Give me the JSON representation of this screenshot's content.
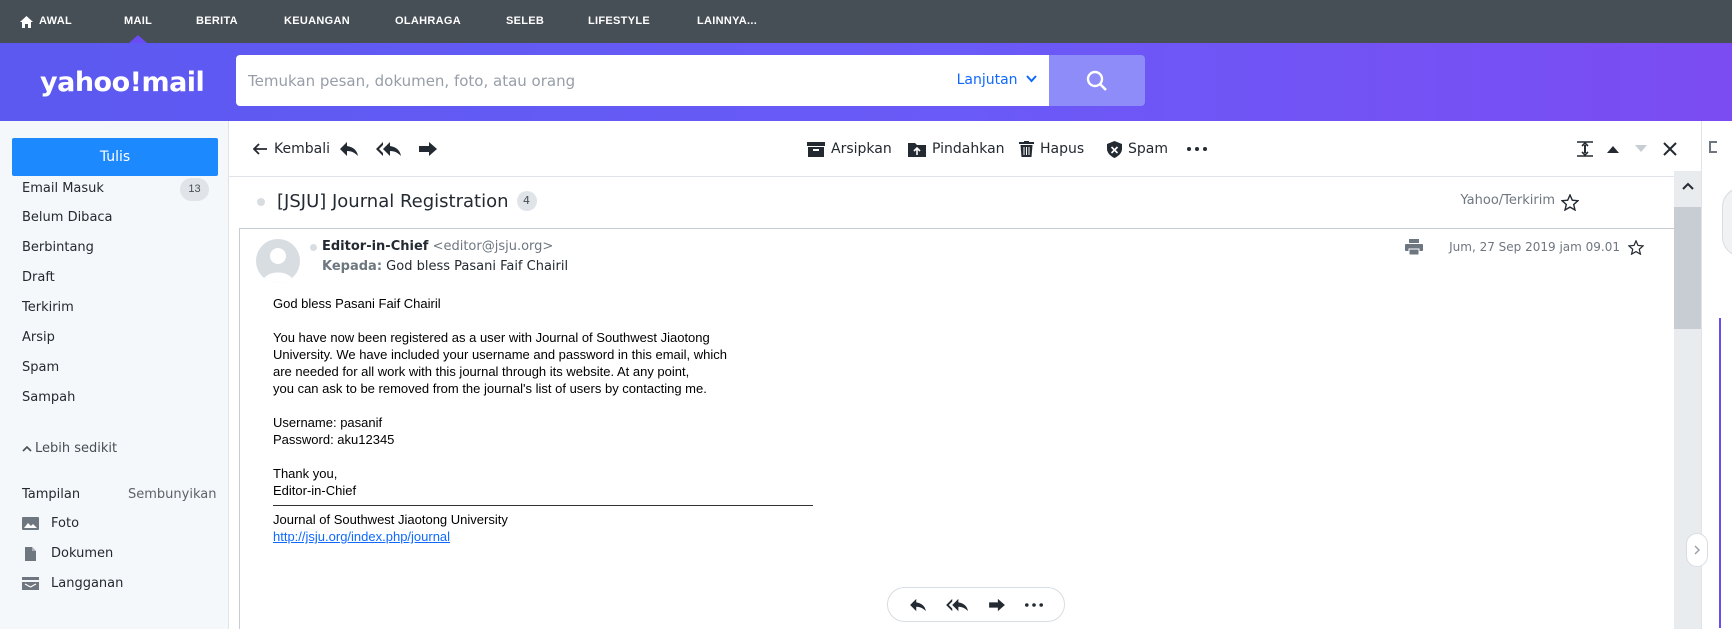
{
  "nav": {
    "items": [
      "AWAL",
      "MAIL",
      "BERITA",
      "KEUANGAN",
      "OLAHRAGA",
      "SELEB",
      "LIFESTYLE",
      "LAINNYA..."
    ],
    "active": "MAIL"
  },
  "header": {
    "logo": "yahoo!mail",
    "search_placeholder": "Temukan pesan, dokumen, foto, atau orang",
    "advanced_label": "Lanjutan"
  },
  "sidebar": {
    "compose_label": "Tulis",
    "folders": [
      {
        "label": "Email Masuk",
        "count": "13"
      },
      {
        "label": "Belum Dibaca"
      },
      {
        "label": "Berbintang"
      },
      {
        "label": "Draft"
      },
      {
        "label": "Terkirim"
      },
      {
        "label": "Arsip"
      },
      {
        "label": "Spam"
      },
      {
        "label": "Sampah"
      }
    ],
    "less_label": "Lebih sedikit",
    "views_label": "Tampilan",
    "views_hide": "Sembunyikan",
    "views": [
      {
        "label": "Foto",
        "icon": "photo-icon"
      },
      {
        "label": "Dokumen",
        "icon": "document-icon"
      },
      {
        "label": "Langganan",
        "icon": "subscriptions-icon"
      }
    ]
  },
  "toolbar": {
    "back_label": "Kembali",
    "archive_label": "Arsipkan",
    "move_label": "Pindahkan",
    "delete_label": "Hapus",
    "spam_label": "Spam"
  },
  "message": {
    "subject": "[JSJU] Journal Registration",
    "thread_count": "4",
    "folder_tag": "Yahoo/Terkirim",
    "sender_name": "Editor-in-Chief",
    "sender_email": "<editor@jsju.org>",
    "recipient_label": "Kepada:",
    "recipient": "God bless Pasani Faif Chairil",
    "date": "Jum, 27 Sep 2019 jam 09.01",
    "greeting": "God bless Pasani Faif Chairil",
    "paragraph_lines": [
      "You have now been registered as a user with Journal of Southwest Jiaotong",
      "University. We have included your username and password in this email, which",
      "are needed for all work with this journal through its website. At any point,",
      "you can ask to be removed from the journal's list of users by contacting me."
    ],
    "username": "Username: pasanif",
    "password": "Password: aku12345",
    "closing": "Thank you,",
    "signature": "Editor-in-Chief",
    "journal": "Journal of Southwest Jiaotong University",
    "link": "http://jsju.org/index.php/journal"
  },
  "colors": {
    "nav_bg": "#464e56",
    "header_gradient_start": "#5b59f0",
    "header_gradient_end": "#7b4cf2",
    "compose_bg": "#1d89ff",
    "link": "#0f69ff"
  }
}
